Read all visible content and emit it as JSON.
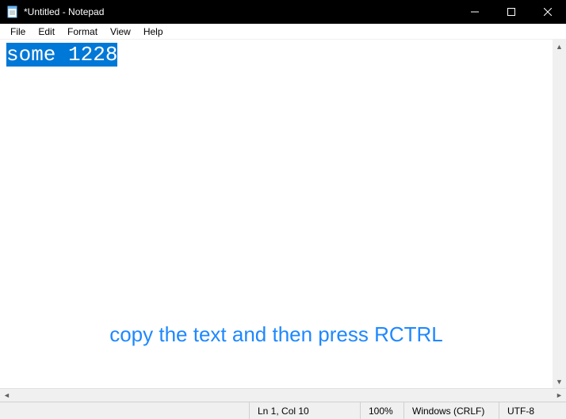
{
  "titlebar": {
    "title": "*Untitled - Notepad"
  },
  "menu": {
    "file": "File",
    "edit": "Edit",
    "format": "Format",
    "view": "View",
    "help": "Help"
  },
  "editor": {
    "selected_text": "some 1228"
  },
  "overlay": {
    "instruction": "copy the text and then press RCTRL"
  },
  "status": {
    "position": "Ln 1, Col 10",
    "zoom": "100%",
    "line_ending": "Windows (CRLF)",
    "encoding": "UTF-8"
  }
}
